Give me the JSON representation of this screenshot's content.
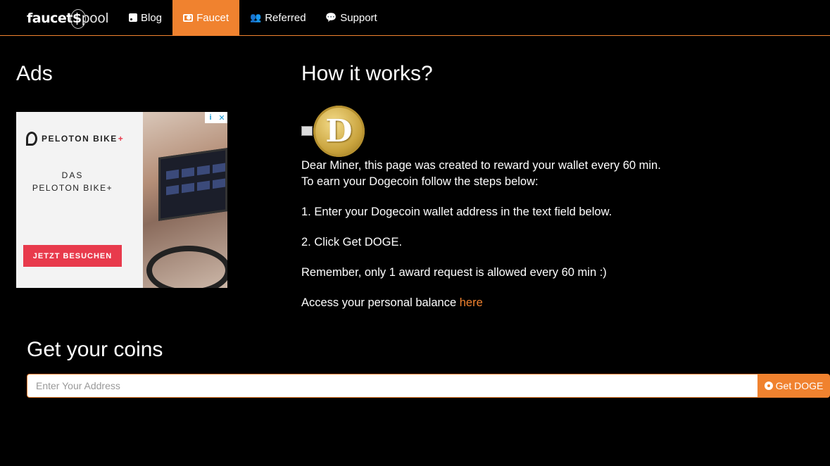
{
  "brand": {
    "part1": "faucet",
    "dollar": "$",
    "part2": "pool"
  },
  "nav": [
    {
      "label": "Blog",
      "icon": "rss-icon"
    },
    {
      "label": "Faucet",
      "icon": "money-icon",
      "active": true
    },
    {
      "label": "Referred",
      "icon": "users-icon"
    },
    {
      "label": "Support",
      "icon": "comments-icon"
    }
  ],
  "ads": {
    "heading": "Ads",
    "brand_name": "PELOTON BIKE",
    "brand_plus": "+",
    "line1": "DAS",
    "line2": "PELOTON BIKE+",
    "button": "JETZT BESUCHEN",
    "choices_info": "i",
    "choices_close": "✕"
  },
  "how": {
    "heading": "How it works?",
    "coin_letter": "D",
    "line1": "Dear Miner, this page was created to reward your wallet every 60 min.",
    "line2": "To earn your Dogecoin follow the steps below:",
    "step1": "1. Enter your Dogecoin wallet address in the text field below.",
    "step2": "2. Click Get DOGE.",
    "remember": "Remember, only 1 award request is allowed every 60 min :)",
    "balance_text": "Access your personal balance ",
    "balance_link": "here"
  },
  "form": {
    "heading": "Get your coins",
    "placeholder": "Enter Your Address",
    "button": "Get DOGE"
  },
  "colors": {
    "accent": "#f0822f",
    "background": "#000000",
    "ad_red": "#e83a4c"
  }
}
